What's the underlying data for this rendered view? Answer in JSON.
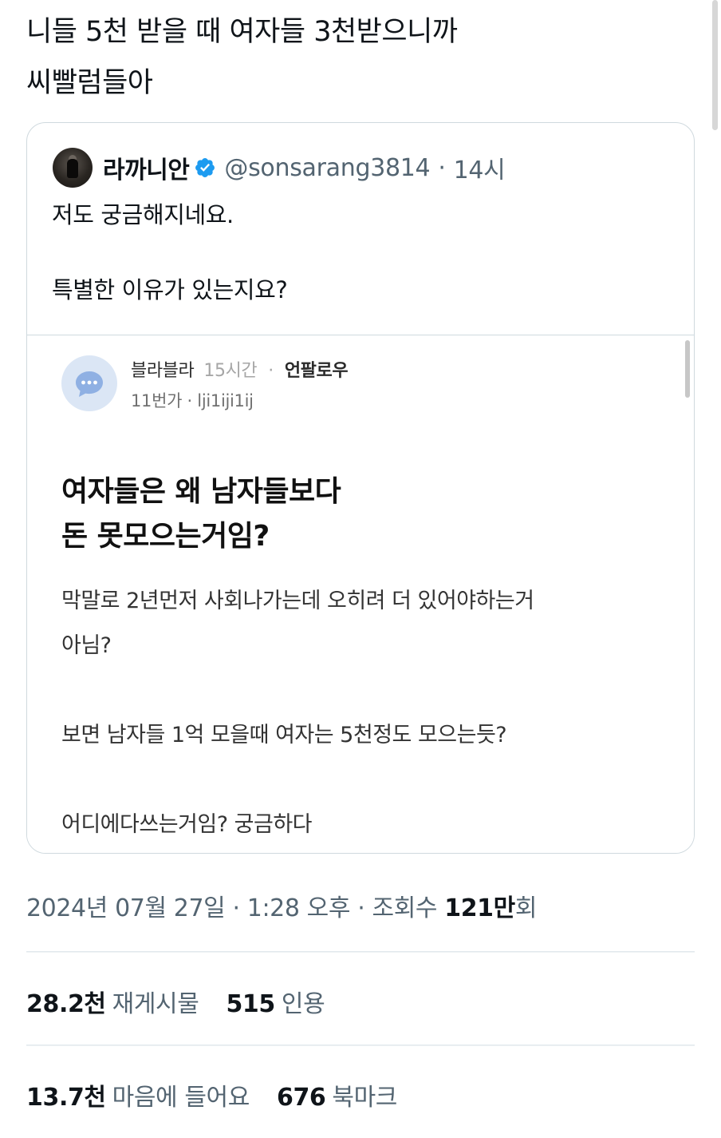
{
  "tweet": {
    "text_line1": "니들 5천 받을 때 여자들 3천받으니까",
    "text_line2": "씨빨럼들아"
  },
  "quoted_tweet": {
    "display_name": "라까니안",
    "verified": true,
    "handle": "@sonsarang3814",
    "separator": "·",
    "time": "14시",
    "text": "저도 궁금해지네요.\n\n특별한 이유가 있는지요?",
    "attached_screenshot": {
      "username": "블라블라",
      "age": "15시간",
      "separator": "·",
      "follow_label": "언팔로우",
      "subline": "11번가 · lji1iji1ij",
      "title": "여자들은 왜 남자들보다\n돈 못모으는거임?",
      "body": "막말로 2년먼저 사회나가는데 오히려 더 있어야하는거\n아님?\n\n보면 남자들 1억 모을때 여자는 5천정도 모으는듯?\n\n어디에다쓰는거임? 궁금하다"
    }
  },
  "timestamp": {
    "date_time": "2024년 07월 27일 · 1:28 오후 · 조회수 ",
    "views_count": "121만",
    "views_suffix": "회"
  },
  "stats": {
    "retweets": {
      "count": "28.2천",
      "label": "재게시물"
    },
    "quotes": {
      "count": "515",
      "label": "인용"
    },
    "likes": {
      "count": "13.7천",
      "label": "마음에 들어요"
    },
    "bookmarks": {
      "count": "676",
      "label": "북마크"
    }
  },
  "colors": {
    "text_primary": "#0f1419",
    "text_secondary": "#536471",
    "border": "#cfd9de",
    "verified_blue": "#1d9bf0",
    "blind_avatar_bg": "#dbe6f5",
    "blind_icon": "#8fb0e3"
  },
  "icons": {
    "verified": "verified-badge-icon",
    "blind_avatar": "chat-bubble-icon"
  }
}
